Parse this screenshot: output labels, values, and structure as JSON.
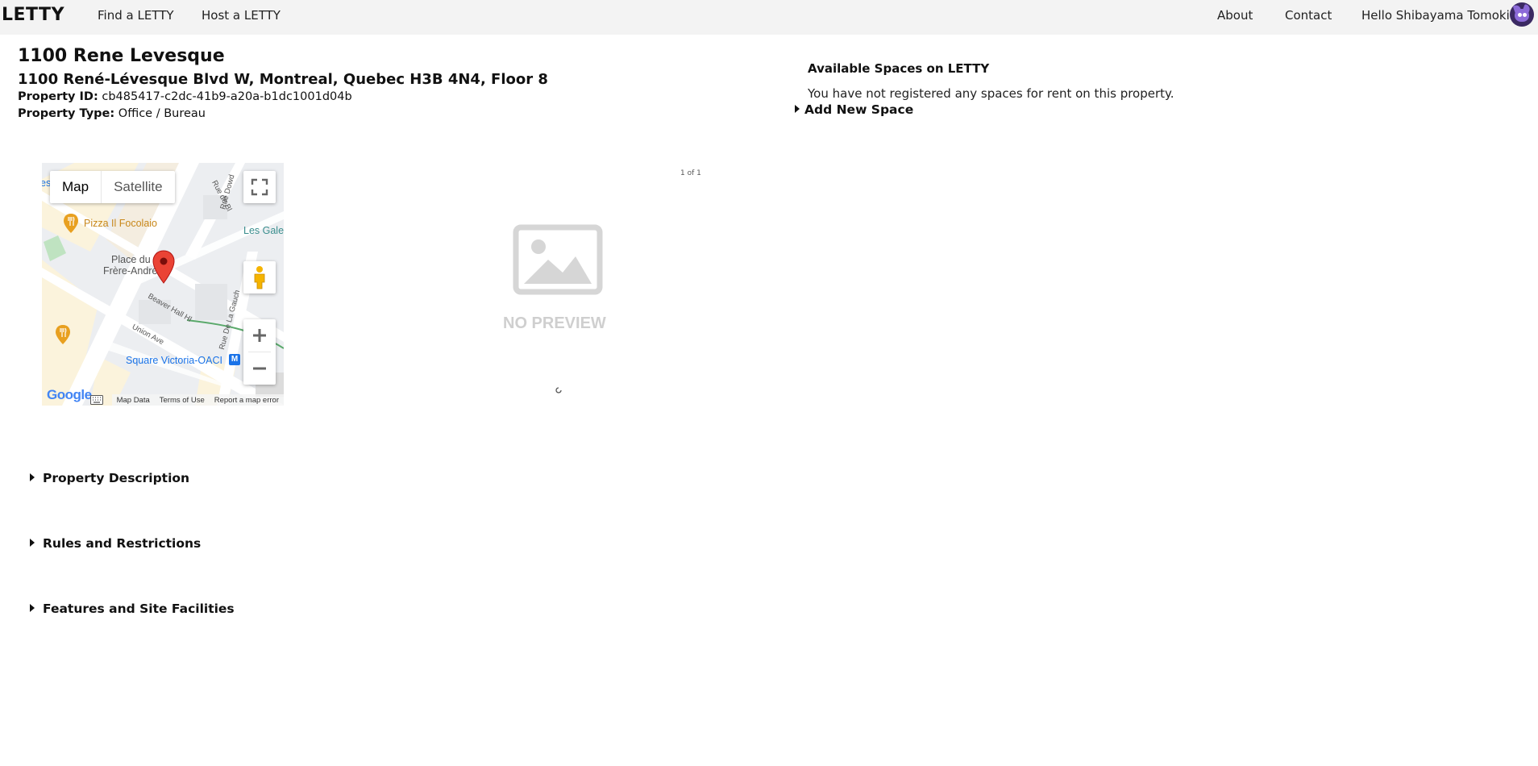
{
  "nav": {
    "brand": "LETTY",
    "find": "Find a LETTY",
    "host": "Host a LETTY",
    "about": "About",
    "contact": "Contact",
    "greeting": "Hello Shibayama Tomoki"
  },
  "property": {
    "name": "1100 Rene Levesque",
    "address": "1100 René-Lévesque Blvd W, Montreal, Quebec H3B 4N4, Floor 8",
    "id_label": "Property ID:",
    "id_value": "cb485417-c2dc-41b9-a20a-b1dc1001d04b",
    "type_label": "Property Type:",
    "type_value": "Office / Bureau"
  },
  "spaces": {
    "title": "Available Spaces on LETTY",
    "message": "You have not registered any spaces for rent on this property.",
    "add_label": "Add New Space"
  },
  "map": {
    "type_map": "Map",
    "type_satellite": "Satellite",
    "labels": {
      "pizza": "Pizza Il Focolaio",
      "place_1": "Place du",
      "place_2": "Frère-André",
      "les_gale": "Les Gale",
      "rue_de_bl": "Rue de Bl",
      "rue_dowd": "Rue Dowd",
      "beaver": "Beaver Hall Hl",
      "union": "Union Ave",
      "rue_gauche": "Rue De La Gauch",
      "square": "Square Victoria-OACI",
      "es": "es"
    },
    "metro_badge": "M",
    "footer": {
      "logo": "Google",
      "map_data": "Map Data",
      "terms": "Terms of Use",
      "report": "Report a map error"
    },
    "icons": [
      "fullscreen-icon",
      "pegman-icon",
      "zoom-in-icon",
      "zoom-out-icon",
      "keyboard-icon",
      "map-pin-icon",
      "restaurant-icon"
    ]
  },
  "preview": {
    "page_count": "1 of 1",
    "placeholder": "NO PREVIEW"
  },
  "sections": {
    "description": "Property Description",
    "rules": "Rules and Restrictions",
    "features": "Features and Site Facilities"
  },
  "colors": {
    "navbar_bg": "#f3f3f3",
    "pin": "#ea4335",
    "metro": "#1a73e8",
    "poi": "#e8a020",
    "preview_gray": "#cfcfcf"
  }
}
